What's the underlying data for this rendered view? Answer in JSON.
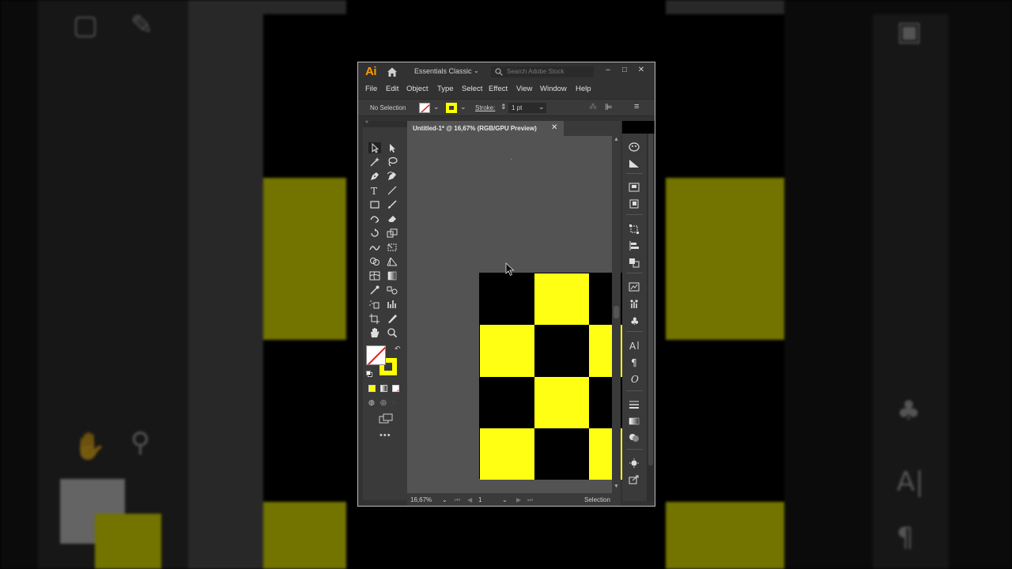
{
  "app": {
    "logo": "Ai",
    "workspace": "Essentials Classic",
    "search_placeholder": "Search Adobe Stock"
  },
  "window_controls": {
    "minimize": "–",
    "restore": "□",
    "close": "✕"
  },
  "menu": [
    "File",
    "Edit",
    "Object",
    "Type",
    "Select",
    "Effect",
    "View",
    "Window",
    "Help"
  ],
  "control_bar": {
    "selection": "No Selection",
    "stroke_label": "Stroke:",
    "stroke_value": "1 pt"
  },
  "document": {
    "tab_title": "Untitled-1* @ 16,67% (RGB/GPU Preview)",
    "close": "✕"
  },
  "status": {
    "zoom": "16,67%",
    "artboard": "1",
    "tool": "Selection"
  },
  "artwork": {
    "rows": 4,
    "cols": 3,
    "pattern": [
      [
        "black",
        "yellow",
        "black"
      ],
      [
        "yellow",
        "black",
        "yellow"
      ],
      [
        "black",
        "yellow",
        "black"
      ],
      [
        "yellow",
        "black",
        "yellow"
      ]
    ],
    "colors": {
      "black": "#000000",
      "yellow": "#ffff14"
    }
  },
  "colors": {
    "accent_logo": "#ff9a00",
    "fill": "#ffffff",
    "stroke": "#ffff00"
  }
}
